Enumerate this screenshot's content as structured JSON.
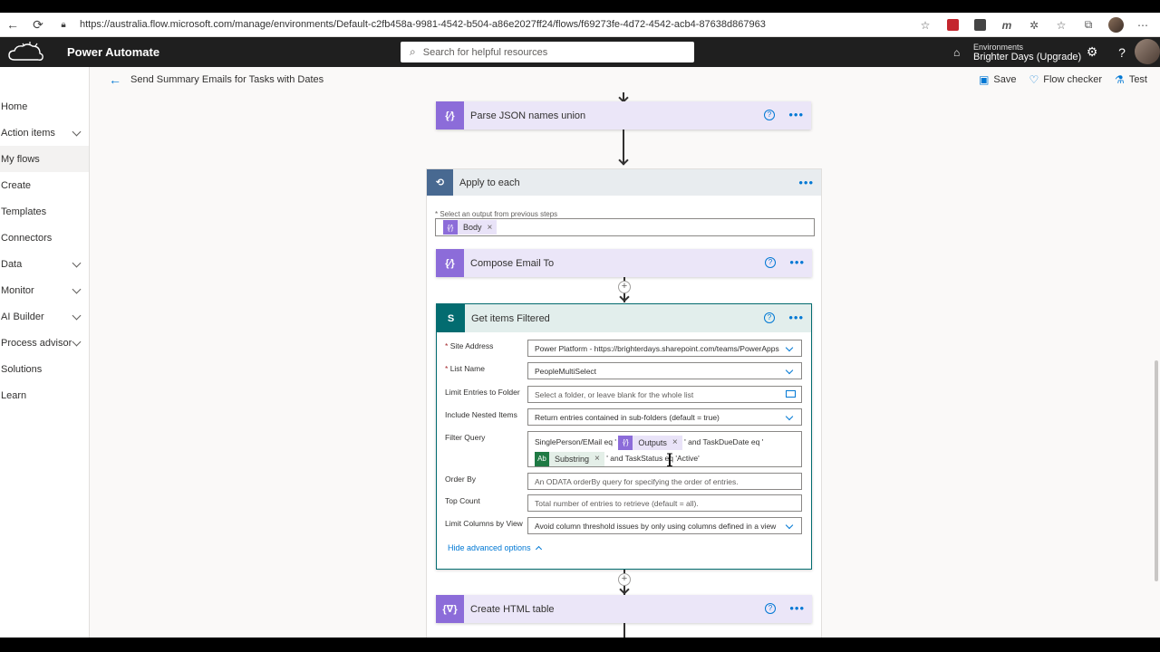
{
  "browser": {
    "url": "https://australia.flow.microsoft.com/manage/environments/Default-c2fb458a-9981-4542-b504-a86e2027ff24/flows/f69273fe-4d72-4542-acb4-87638d867963"
  },
  "header": {
    "app_name": "Power Automate",
    "search_placeholder": "Search for helpful resources",
    "env_label": "Environments",
    "env_name": "Brighter Days (Upgrade)"
  },
  "nav": {
    "items": [
      {
        "label": "Home"
      },
      {
        "label": "Action items"
      },
      {
        "label": "My flows"
      },
      {
        "label": "Create"
      },
      {
        "label": "Templates"
      },
      {
        "label": "Connectors"
      },
      {
        "label": "Data"
      },
      {
        "label": "Monitor"
      },
      {
        "label": "AI Builder"
      },
      {
        "label": "Process advisor"
      },
      {
        "label": "Solutions"
      },
      {
        "label": "Learn"
      }
    ]
  },
  "commandbar": {
    "flow_title": "Send Summary Emails for Tasks with Dates",
    "save": "Save",
    "flow_checker": "Flow checker",
    "test": "Test"
  },
  "flow": {
    "parse_json": "Parse JSON names union",
    "apply_each": "Apply to each",
    "select_output_label": "* Select an output from previous steps",
    "body_token": "Body",
    "compose": "Compose Email To",
    "get_items": {
      "title": "Get items Filtered",
      "site_address_label": "Site Address",
      "site_address_value": "Power Platform - https://brighterdays.sharepoint.com/teams/PowerApps",
      "list_name_label": "List Name",
      "list_name_value": "PeopleMultiSelect",
      "limit_folder_label": "Limit Entries to Folder",
      "limit_folder_placeholder": "Select a folder, or leave blank for the whole list",
      "nested_label": "Include Nested Items",
      "nested_value": "Return entries contained in sub-folders (default = true)",
      "filter_label": "Filter Query",
      "filter_part1": "SinglePerson/EMail eq '",
      "outputs_token": "Outputs",
      "filter_part2": "' and TaskDueDate eq '",
      "substring_token": "Substring",
      "filter_part3": "' and TaskStatus eq 'Active'",
      "orderby_label": "Order By",
      "orderby_placeholder": "An ODATA orderBy query for specifying the order of entries.",
      "topcount_label": "Top Count",
      "topcount_placeholder": "Total number of entries to retrieve (default = all).",
      "limit_columns_label": "Limit Columns by View",
      "limit_columns_value": "Avoid column threshold issues by only using columns defined in a view",
      "hide_advanced": "Hide advanced options"
    },
    "html_table": "Create HTML table"
  },
  "colors": {
    "purple_action": "#8c6cd9",
    "sharepoint_teal": "#036c70",
    "accent": "#0078d4"
  }
}
